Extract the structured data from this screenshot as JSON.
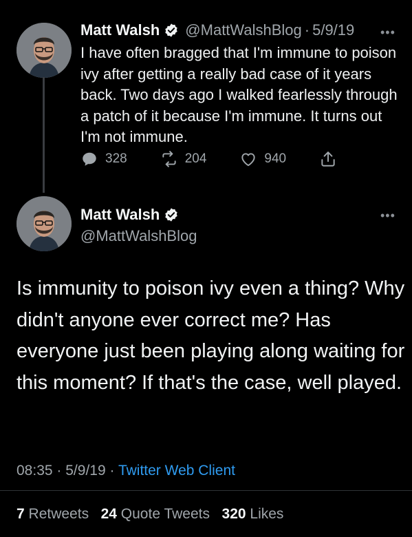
{
  "first_tweet": {
    "author_name": "Matt Walsh",
    "handle": "@MattWalshBlog",
    "separator": "·",
    "date": "5/9/19",
    "text": "I have often bragged that I'm immune to poison ivy after getting a really bad case of it years back. Two days ago I walked fearlessly through a patch of it because I'm immune. It turns out I'm not immune.",
    "replies": "328",
    "retweets": "204",
    "likes": "940"
  },
  "main_tweet": {
    "author_name": "Matt Walsh",
    "handle": "@MattWalshBlog",
    "text": "Is immunity to poison ivy even a thing? Why didn't anyone ever correct me? Has everyone just been playing along waiting for this moment? If that's the case, well played.",
    "time": "08:35",
    "date": "5/9/19",
    "separator": "·",
    "client": "Twitter Web Client",
    "stats": {
      "retweets_count": "7",
      "retweets_label": "Retweets",
      "quote_count": "24",
      "quote_label": "Quote Tweets",
      "likes_count": "320",
      "likes_label": "Likes"
    }
  },
  "icons": {
    "verified": "verified-badge-icon",
    "reply": "reply-icon",
    "retweet": "retweet-icon",
    "like": "heart-icon",
    "share": "share-icon",
    "more": "more-icon"
  },
  "more_glyph": "•••",
  "colors": {
    "background": "#000000",
    "text": "#e7e9ea",
    "secondary": "#a0a6ab",
    "link": "#2f9bf0"
  }
}
